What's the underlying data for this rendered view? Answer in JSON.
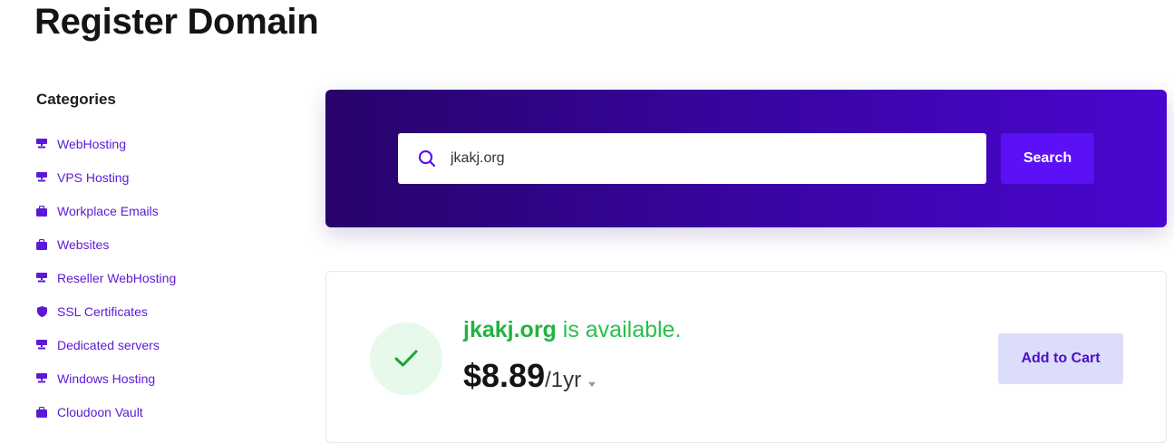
{
  "page": {
    "title": "Register Domain"
  },
  "sidebar": {
    "heading": "Categories",
    "items": [
      {
        "label": "WebHosting",
        "icon": "server-icon"
      },
      {
        "label": "VPS Hosting",
        "icon": "server-icon"
      },
      {
        "label": "Workplace Emails",
        "icon": "briefcase-icon"
      },
      {
        "label": "Websites",
        "icon": "briefcase-icon"
      },
      {
        "label": "Reseller WebHosting",
        "icon": "server-icon"
      },
      {
        "label": "SSL Certificates",
        "icon": "shield-icon"
      },
      {
        "label": "Dedicated servers",
        "icon": "server-icon"
      },
      {
        "label": "Windows Hosting",
        "icon": "server-icon"
      },
      {
        "label": "Cloudoon Vault",
        "icon": "briefcase-icon"
      }
    ]
  },
  "search": {
    "value": "jkakj.org",
    "placeholder": "",
    "button_label": "Search",
    "icon": "search-icon"
  },
  "result": {
    "domain": "jkakj.org",
    "status_text": " is available.",
    "price": "$8.89",
    "period": "/1yr",
    "add_to_cart_label": "Add to Cart",
    "status_icon": "checkmark-icon"
  },
  "colors": {
    "accent": "#5b10f5",
    "link": "#5b19d6",
    "success": "#28c04a",
    "panel_gradient_start": "#27046a",
    "panel_gradient_end": "#4a06cf"
  }
}
